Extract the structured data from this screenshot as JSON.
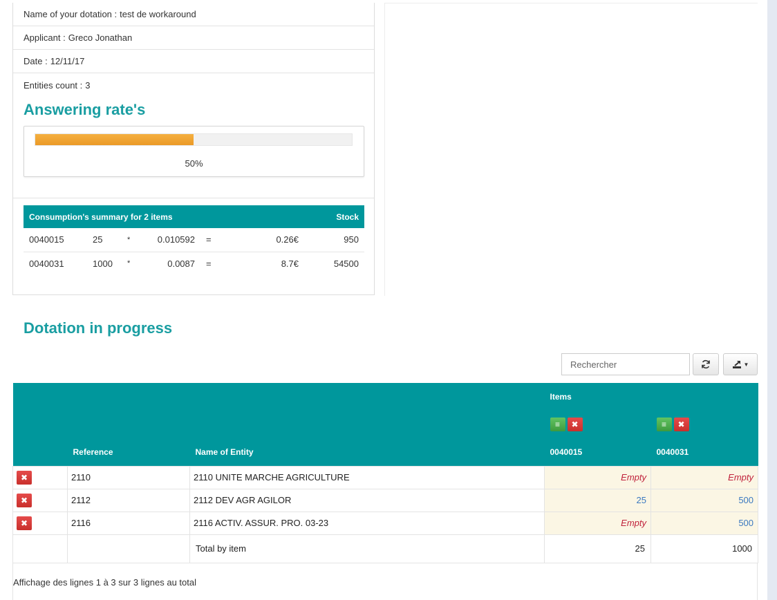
{
  "info": {
    "dotation_label": "Name of your dotation :",
    "dotation_value": "test de workaround",
    "applicant_label": "Applicant :",
    "applicant_value": "Greco Jonathan",
    "date_label": "Date :",
    "date_value": "12/11/17",
    "entities_label": "Entities count :",
    "entities_value": "3"
  },
  "answering": {
    "title": "Answering rate's",
    "percent": 50,
    "percent_text": "50%",
    "bar_color": "#eb9a27"
  },
  "summary": {
    "header": "Consumption's summary for 2 items",
    "stock_header": "Stock",
    "rows": [
      {
        "code": "0040015",
        "qty": "25",
        "op1": "*",
        "price": "0.010592",
        "op2": "=",
        "total": "0.26€",
        "stock": "950"
      },
      {
        "code": "0040031",
        "qty": "1000",
        "op1": "*",
        "price": "0.0087",
        "op2": "=",
        "total": "8.7€",
        "stock": "54500"
      }
    ]
  },
  "dotation": {
    "title": "Dotation in progress",
    "search_placeholder": "Rechercher",
    "refresh_icon": "refresh-icon",
    "export_icon": "export-icon",
    "columns": {
      "items_group": "Items",
      "reference": "Reference",
      "entity": "Name of Entity",
      "item1": "0040015",
      "item2": "0040031"
    },
    "rows": [
      {
        "reference": "2110",
        "entity": "2110 UNITE MARCHE AGRICULTURE",
        "item1": "Empty",
        "item2": "Empty"
      },
      {
        "reference": "2112",
        "entity": "2112 DEV AGR AGILOR",
        "item1": "25",
        "item2": "500"
      },
      {
        "reference": "2116",
        "entity": "2116 ACTIV. ASSUR. PRO. 03-23",
        "item1": "Empty",
        "item2": "500"
      }
    ],
    "total_label": "Total by item",
    "total_item1": "25",
    "total_item2": "1000",
    "pagination": "Affichage des lignes 1 à 3 sur 3 lignes au total"
  },
  "colors": {
    "accent": "#00979c",
    "title": "#1a9ea2",
    "empty": "#c0203a",
    "value": "#3b79c0",
    "cell_bg": "#fbf6e4"
  }
}
